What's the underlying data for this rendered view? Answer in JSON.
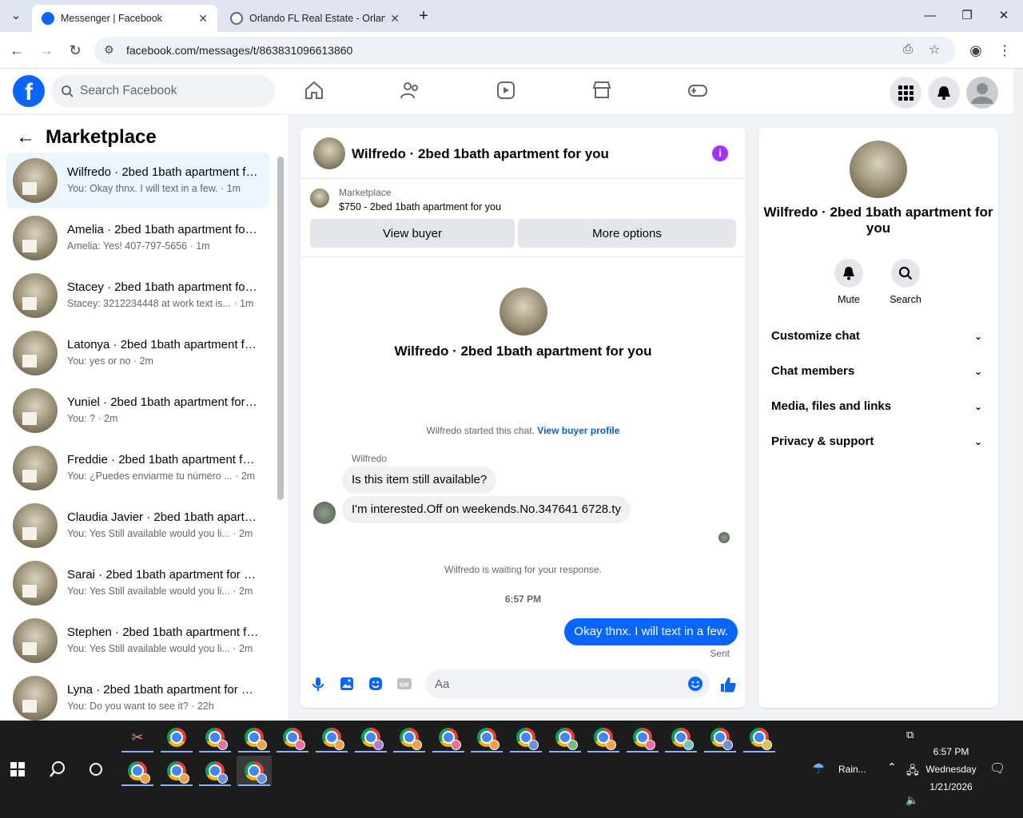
{
  "browser": {
    "tabs": [
      {
        "title": "Messenger | Facebook"
      },
      {
        "title": "Orlando FL Real Estate - Orland"
      }
    ],
    "url": "facebook.com/messages/t/863831096613860"
  },
  "header": {
    "search_placeholder": "Search Facebook"
  },
  "sidebar": {
    "title": "Marketplace",
    "conversations": [
      {
        "name": "Wilfredo · 2bed 1bath apartment for you",
        "snippet": "You: Okay thnx. I will text in a few.",
        "time": "1m",
        "selected": true
      },
      {
        "name": "Amelia · 2bed 1bath apartment for you",
        "snippet": "Amelia: Yes! 407-797-5656",
        "time": "1m"
      },
      {
        "name": "Stacey · 2bed 1bath apartment for you",
        "snippet": "Stacey: 3212234448 at work text is...",
        "time": "1m"
      },
      {
        "name": "Latonya · 2bed 1bath apartment for you",
        "snippet": "You: yes or no",
        "time": "2m"
      },
      {
        "name": "Yuniel · 2bed 1bath apartment for you",
        "snippet": "You: ?",
        "time": "2m"
      },
      {
        "name": "Freddie · 2bed 1bath apartment for you",
        "snippet": "You: ¿Puedes enviarme tu número ...",
        "time": "2m"
      },
      {
        "name": "Claudia Javier · 2bed 1bath apartment for you",
        "snippet": "You: Yes Still available would you li...",
        "time": "2m"
      },
      {
        "name": "Sarai · 2bed 1bath apartment for you",
        "snippet": "You: Yes Still available would you li...",
        "time": "2m"
      },
      {
        "name": "Stephen · 2bed 1bath apartment for you",
        "snippet": "You: Yes Still available would you li...",
        "time": "2m"
      },
      {
        "name": "Lyna · 2bed 1bath apartment for you",
        "snippet": "You: Do you want to see it?",
        "time": "22h"
      }
    ]
  },
  "chat": {
    "title": "Wilfredo · 2bed 1bath apartment for you",
    "marketplace_label": "Marketplace",
    "listing": "$750 - 2bed 1bath apartment for you",
    "view_buyer": "View buyer",
    "more_options": "More options",
    "intro_name": "Wilfredo · 2bed 1bath apartment for you",
    "started_text": "Wilfredo started this chat.",
    "view_buyer_profile": "View buyer profile",
    "sender_label": "Wilfredo",
    "messages_in": [
      "Is this item still available?",
      "I'm interested.Off on weekends.No.347641 6728.ty"
    ],
    "waiting_text": "Wilfredo is waiting for your response.",
    "timestamp": "6:57 PM",
    "message_out": "Okay thnx. I will text in a few.",
    "sent_label": "Sent",
    "composer_placeholder": "Aa"
  },
  "info": {
    "title": "Wilfredo · 2bed 1bath apartment for you",
    "mute": "Mute",
    "search": "Search",
    "sections": [
      "Customize chat",
      "Chat members",
      "Media, files and links",
      "Privacy & support"
    ]
  },
  "taskbar": {
    "weather": "Rain...",
    "time": "6:57 PM",
    "day": "Wednesday",
    "date": "1/21/2026"
  }
}
